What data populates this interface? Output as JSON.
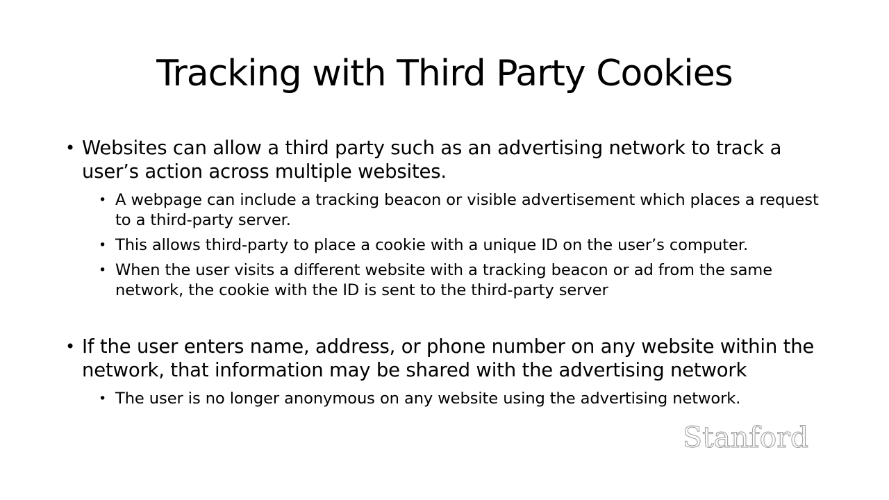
{
  "slide": {
    "title": "Tracking with Third Party Cookies",
    "points": [
      {
        "text": "Websites can allow a third party such as an advertising network to track a user’s action across multiple websites.",
        "subpoints": [
          "A webpage can include a tracking beacon or visible advertisement which places a request to a third-party server.",
          "This allows third-party to place a cookie with a unique ID on the user’s computer.",
          "When the user visits a different website with a tracking beacon or ad from the same network, the cookie with the ID is sent to the third-party server"
        ]
      },
      {
        "text": "If the user enters name, address, or phone number on any website within the network, that information may be shared with the advertising network",
        "subpoints": [
          "The user is no longer anonymous on any website using the advertising network."
        ]
      }
    ],
    "bullet_glyph": "•",
    "logo_text": "Stanford"
  }
}
